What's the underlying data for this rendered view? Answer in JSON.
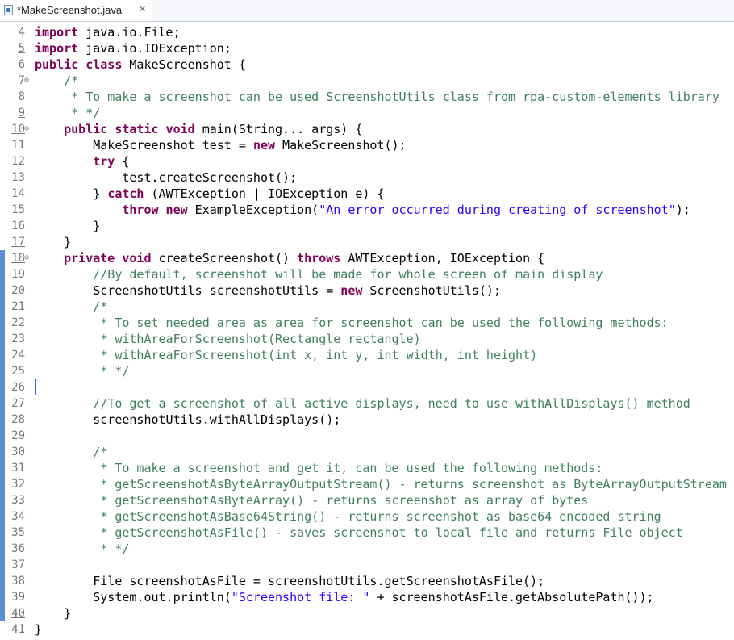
{
  "tab": {
    "title": "*MakeScreenshot.java",
    "close_glyph": "✕",
    "icon": "java-file-icon"
  },
  "editor": {
    "lines": [
      {
        "n": "4",
        "u": false,
        "fold": "",
        "bar": false,
        "tok": [
          [
            "k",
            "import"
          ],
          [
            "",
            "java.io.File;"
          ]
        ]
      },
      {
        "n": "5",
        "u": true,
        "fold": "",
        "bar": false,
        "tok": [
          [
            "k",
            "import"
          ],
          [
            "",
            "java.io.IOException;"
          ]
        ]
      },
      {
        "n": "6",
        "u": true,
        "fold": "",
        "bar": false,
        "tok": [
          [
            "k",
            "public class"
          ],
          [
            "",
            " MakeScreenshot {"
          ]
        ]
      },
      {
        "n": "7",
        "u": false,
        "fold": "⊖",
        "bar": false,
        "tok": [
          [
            "",
            "    "
          ],
          [
            "c",
            "/*"
          ]
        ]
      },
      {
        "n": "8",
        "u": false,
        "fold": "",
        "bar": false,
        "tok": [
          [
            "",
            "     "
          ],
          [
            "c",
            "* To make a screenshot can be used ScreenshotUtils class from rpa-custom-elements library"
          ]
        ]
      },
      {
        "n": "9",
        "u": true,
        "fold": "",
        "bar": false,
        "tok": [
          [
            "",
            "     "
          ],
          [
            "c",
            "* */"
          ]
        ]
      },
      {
        "n": "10",
        "u": true,
        "fold": "⊖",
        "bar": false,
        "tok": [
          [
            "",
            "    "
          ],
          [
            "k",
            "public static void"
          ],
          [
            "",
            " main(String... args) {"
          ]
        ]
      },
      {
        "n": "11",
        "u": false,
        "fold": "",
        "bar": false,
        "tok": [
          [
            "",
            "        MakeScreenshot test = "
          ],
          [
            "k",
            "new"
          ],
          [
            "",
            " MakeScreenshot();"
          ]
        ]
      },
      {
        "n": "12",
        "u": false,
        "fold": "",
        "bar": false,
        "tok": [
          [
            "",
            "        "
          ],
          [
            "k",
            "try"
          ],
          [
            "",
            " {"
          ]
        ]
      },
      {
        "n": "13",
        "u": false,
        "fold": "",
        "bar": false,
        "tok": [
          [
            "",
            "            test.createScreenshot();"
          ]
        ]
      },
      {
        "n": "14",
        "u": false,
        "fold": "",
        "bar": false,
        "tok": [
          [
            "",
            "        } "
          ],
          [
            "k",
            "catch"
          ],
          [
            "",
            " (AWTException | IOException e) {"
          ]
        ]
      },
      {
        "n": "15",
        "u": false,
        "fold": "",
        "bar": false,
        "tok": [
          [
            "",
            "            "
          ],
          [
            "k",
            "throw new"
          ],
          [
            "",
            " ExampleException("
          ],
          [
            "s",
            "\"An error occurred during creating of screenshot\""
          ],
          [
            "",
            ");"
          ]
        ]
      },
      {
        "n": "16",
        "u": false,
        "fold": "",
        "bar": false,
        "tok": [
          [
            "",
            "        }"
          ]
        ]
      },
      {
        "n": "17",
        "u": true,
        "fold": "",
        "bar": false,
        "tok": [
          [
            "",
            "    }"
          ]
        ]
      },
      {
        "n": "18",
        "u": true,
        "fold": "⊖",
        "bar": true,
        "tok": [
          [
            "",
            "    "
          ],
          [
            "k",
            "private void"
          ],
          [
            "",
            " createScreenshot() "
          ],
          [
            "k",
            "throws"
          ],
          [
            "",
            " AWTException, IOException {"
          ]
        ]
      },
      {
        "n": "19",
        "u": false,
        "fold": "",
        "bar": true,
        "tok": [
          [
            "",
            "        "
          ],
          [
            "c",
            "//By default, screenshot will be made for whole screen of main display"
          ]
        ]
      },
      {
        "n": "20",
        "u": true,
        "fold": "",
        "bar": true,
        "tok": [
          [
            "",
            "        ScreenshotUtils screenshotUtils = "
          ],
          [
            "k",
            "new"
          ],
          [
            "",
            " ScreenshotUtils();"
          ]
        ]
      },
      {
        "n": "21",
        "u": false,
        "fold": "",
        "bar": true,
        "tok": [
          [
            "",
            "        "
          ],
          [
            "c",
            "/*"
          ]
        ]
      },
      {
        "n": "22",
        "u": false,
        "fold": "",
        "bar": true,
        "tok": [
          [
            "",
            "         "
          ],
          [
            "c",
            "* To set needed area as area for screenshot can be used the following methods:"
          ]
        ]
      },
      {
        "n": "23",
        "u": false,
        "fold": "",
        "bar": true,
        "tok": [
          [
            "",
            "         "
          ],
          [
            "c",
            "* withAreaForScreenshot(Rectangle rectangle)"
          ]
        ]
      },
      {
        "n": "24",
        "u": false,
        "fold": "",
        "bar": true,
        "tok": [
          [
            "",
            "         "
          ],
          [
            "c",
            "* withAreaForScreenshot(int x, int y, int width, int height)"
          ]
        ]
      },
      {
        "n": "25",
        "u": false,
        "fold": "",
        "bar": true,
        "tok": [
          [
            "",
            "         "
          ],
          [
            "c",
            "* */"
          ]
        ]
      },
      {
        "n": "26",
        "u": false,
        "fold": "",
        "bar": true,
        "caret": true,
        "tok": []
      },
      {
        "n": "27",
        "u": false,
        "fold": "",
        "bar": true,
        "tok": [
          [
            "",
            "        "
          ],
          [
            "c",
            "//To get a screenshot of all active displays, need to use withAllDisplays() method"
          ]
        ]
      },
      {
        "n": "28",
        "u": false,
        "fold": "",
        "bar": true,
        "tok": [
          [
            "",
            "        screenshotUtils.withAllDisplays();"
          ]
        ]
      },
      {
        "n": "29",
        "u": false,
        "fold": "",
        "bar": true,
        "tok": []
      },
      {
        "n": "30",
        "u": false,
        "fold": "",
        "bar": true,
        "tok": [
          [
            "",
            "        "
          ],
          [
            "c",
            "/*"
          ]
        ]
      },
      {
        "n": "31",
        "u": false,
        "fold": "",
        "bar": true,
        "tok": [
          [
            "",
            "         "
          ],
          [
            "c",
            "* To make a screenshot and get it, can be used the following methods:"
          ]
        ]
      },
      {
        "n": "32",
        "u": false,
        "fold": "",
        "bar": true,
        "tok": [
          [
            "",
            "         "
          ],
          [
            "c",
            "* getScreenshotAsByteArrayOutputStream() - returns screenshot as ByteArrayOutputStream"
          ]
        ]
      },
      {
        "n": "33",
        "u": false,
        "fold": "",
        "bar": true,
        "tok": [
          [
            "",
            "         "
          ],
          [
            "c",
            "* getScreenshotAsByteArray() - returns screenshot as array of bytes"
          ]
        ]
      },
      {
        "n": "34",
        "u": false,
        "fold": "",
        "bar": true,
        "tok": [
          [
            "",
            "         "
          ],
          [
            "c",
            "* getScreenshotAsBase64String() - returns screenshot as base64 encoded string"
          ]
        ]
      },
      {
        "n": "35",
        "u": false,
        "fold": "",
        "bar": true,
        "tok": [
          [
            "",
            "         "
          ],
          [
            "c",
            "* getScreenshotAsFile() - saves screenshot to local file and returns File object"
          ]
        ]
      },
      {
        "n": "36",
        "u": false,
        "fold": "",
        "bar": true,
        "tok": [
          [
            "",
            "         "
          ],
          [
            "c",
            "* */"
          ]
        ]
      },
      {
        "n": "37",
        "u": false,
        "fold": "",
        "bar": true,
        "tok": []
      },
      {
        "n": "38",
        "u": false,
        "fold": "",
        "bar": true,
        "tok": [
          [
            "",
            "        File screenshotAsFile = screenshotUtils.getScreenshotAsFile();"
          ]
        ]
      },
      {
        "n": "39",
        "u": false,
        "fold": "",
        "bar": true,
        "tok": [
          [
            "",
            "        System.out.println("
          ],
          [
            "s",
            "\"Screenshot file: \""
          ],
          [
            "",
            " + screenshotAsFile.getAbsolutePath());"
          ]
        ]
      },
      {
        "n": "40",
        "u": true,
        "fold": "",
        "bar": true,
        "tok": [
          [
            "",
            "    }"
          ]
        ]
      },
      {
        "n": "41",
        "u": false,
        "fold": "",
        "bar": false,
        "tok": [
          [
            "",
            "}"
          ]
        ]
      }
    ]
  },
  "colors": {
    "keyword": "#7f0055",
    "comment": "#3f7f5f",
    "string": "#2a00ff",
    "change_bar": "#5b8fd2"
  }
}
